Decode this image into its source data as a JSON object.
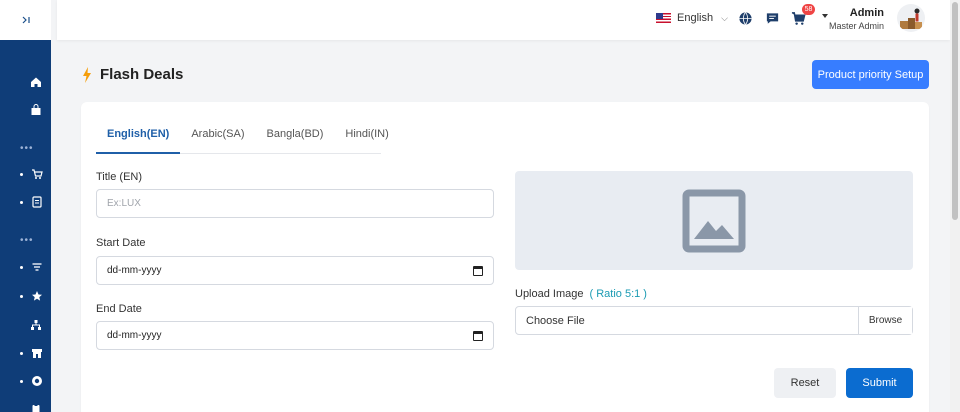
{
  "header": {
    "language": "English",
    "cart_badge": "58",
    "admin_name": "Admin",
    "admin_role": "Master Admin"
  },
  "page": {
    "title": "Flash Deals",
    "priority_button": "Product priority Setup"
  },
  "tabs": [
    {
      "label": "English(EN)",
      "active": true
    },
    {
      "label": "Arabic(SA)",
      "active": false
    },
    {
      "label": "Bangla(BD)",
      "active": false
    },
    {
      "label": "Hindi(IN)",
      "active": false
    }
  ],
  "form": {
    "title_label": "Title (EN)",
    "title_placeholder": "Ex:LUX",
    "start_label": "Start Date",
    "start_value": "dd-mm-yyyy",
    "end_label": "End Date",
    "end_value": "dd-mm-yyyy",
    "upload_label": "Upload Image",
    "upload_ratio": "( Ratio 5:1 )",
    "file_text": "Choose File",
    "browse_label": "Browse",
    "reset_label": "Reset",
    "submit_label": "Submit"
  },
  "colors": {
    "sidebar": "#0f3d78",
    "primary": "#377dff",
    "submit": "#0b6cd0",
    "accent_tab": "#1f5fa8",
    "bolt": "#f59e0b"
  }
}
